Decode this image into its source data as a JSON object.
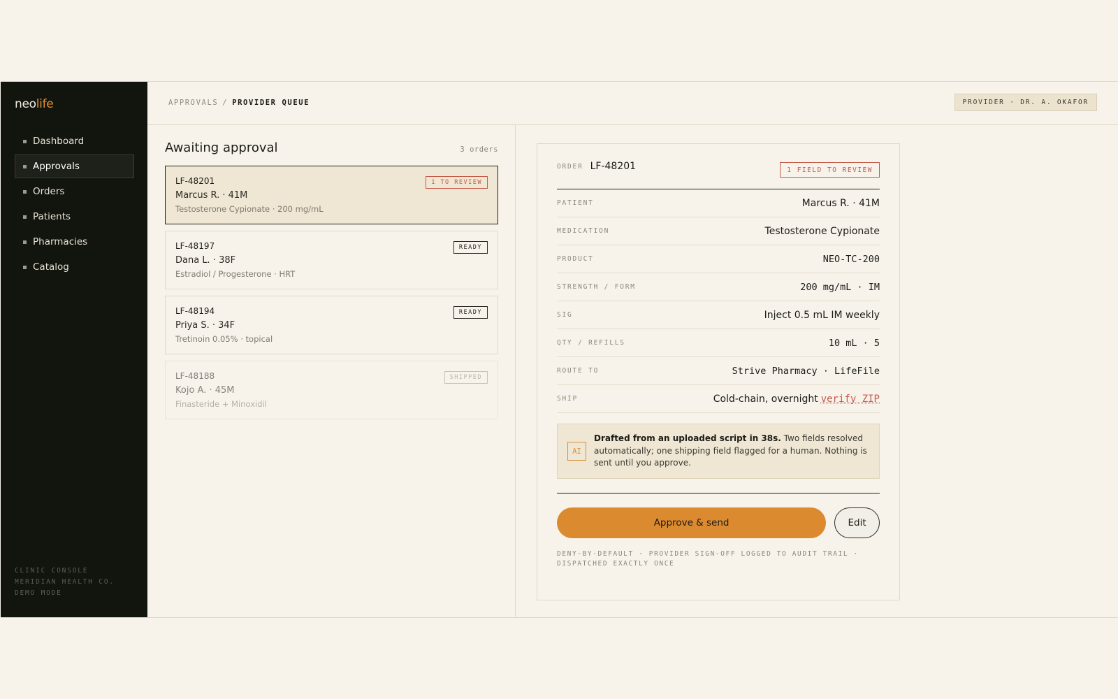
{
  "brand": {
    "part1": "neo",
    "part2": "life",
    "accent": "#e08f34"
  },
  "sidebar": {
    "items": [
      {
        "label": "Dashboard",
        "active": false
      },
      {
        "label": "Approvals",
        "active": true
      },
      {
        "label": "Orders",
        "active": false
      },
      {
        "label": "Patients",
        "active": false
      },
      {
        "label": "Pharmacies",
        "active": false
      },
      {
        "label": "Catalog",
        "active": false
      }
    ],
    "footer": [
      "CLINIC CONSOLE",
      "MERIDIAN HEALTH CO.",
      "DEMO MODE"
    ]
  },
  "topbar": {
    "breadcrumb_parent": "APPROVALS",
    "breadcrumb_sep": "/",
    "breadcrumb_current": "PROVIDER QUEUE",
    "provider": "PROVIDER · DR. A. OKAFOR"
  },
  "queue": {
    "title": "Awaiting approval",
    "count": "3 orders",
    "orders": [
      {
        "id": "LF-48201",
        "patient": "Marcus R. · 41M",
        "med": "Testosterone Cypionate · 200 mg/mL",
        "badge": "1 TO REVIEW",
        "state": "review"
      },
      {
        "id": "LF-48197",
        "patient": "Dana L. · 38F",
        "med": "Estradiol / Progesterone · HRT",
        "badge": "READY",
        "state": "ready"
      },
      {
        "id": "LF-48194",
        "patient": "Priya S. · 34F",
        "med": "Tretinoin 0.05% · topical",
        "badge": "READY",
        "state": "ready"
      },
      {
        "id": "LF-48188",
        "patient": "Kojo A. · 45M",
        "med": "Finasteride + Minoxidil",
        "badge": "SHIPPED",
        "state": "shipped"
      }
    ]
  },
  "detail": {
    "order_label": "ORDER",
    "order_id": "LF-48201",
    "badge": "1 FIELD TO REVIEW",
    "rows": [
      {
        "key": "PATIENT",
        "value": "Marcus R. · 41M"
      },
      {
        "key": "MEDICATION",
        "value": "Testosterone Cypionate"
      },
      {
        "key": "PRODUCT",
        "value": "NEO-TC-200"
      },
      {
        "key": "STRENGTH / FORM",
        "value": "200 mg/mL · IM"
      },
      {
        "key": "SIG",
        "value": "Inject 0.5 mL IM weekly"
      },
      {
        "key": "QTY / REFILLS",
        "value": "10 mL · 5"
      },
      {
        "key": "ROUTE TO",
        "value": "Strive Pharmacy · LifeFile"
      },
      {
        "key": "SHIP",
        "value": "Cold-chain, overnight",
        "link": "verify ZIP"
      }
    ],
    "ai_tag": "AI",
    "ai_bold": "Drafted from an uploaded script in 38s.",
    "ai_text": " Two fields resolved automatically; one shipping field flagged for a human. Nothing is sent until you approve.",
    "approve_label": "Approve & send",
    "edit_label": "Edit",
    "fine_print": "DENY-BY-DEFAULT · PROVIDER SIGN-OFF LOGGED TO AUDIT TRAIL · DISPATCHED EXACTLY ONCE"
  },
  "colors": {
    "sidebar_bg": "#12140e",
    "page_bg": "#f7f3eb",
    "approve": "#dc8a2f",
    "review": "#c45a48"
  }
}
